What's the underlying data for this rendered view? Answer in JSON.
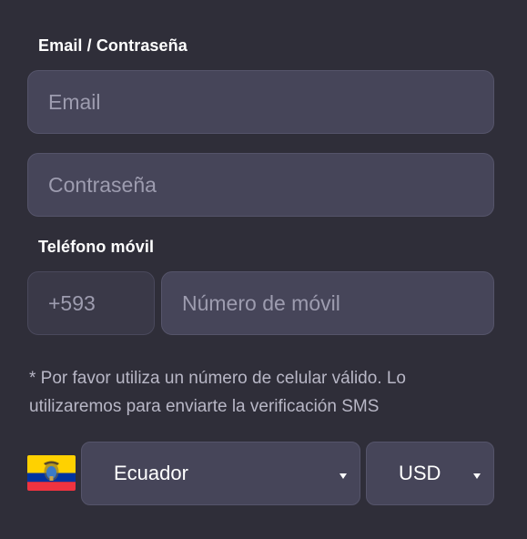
{
  "credentials": {
    "section_label": "Email / Contraseña",
    "email_placeholder": "Email",
    "password_placeholder": "Contraseña"
  },
  "phone": {
    "section_label": "Teléfono móvil",
    "country_code": "+593",
    "number_placeholder": "Número de móvil",
    "note": "* Por favor utiliza un número de celular válido. Lo utilizaremos para enviarte la verificación SMS"
  },
  "country": {
    "flag_icon": "ecuador-flag-icon",
    "selected": "Ecuador"
  },
  "currency": {
    "selected": "USD"
  },
  "colors": {
    "background": "#2f2e39",
    "field": "#464559",
    "flag_yellow": "#ffd100",
    "flag_blue": "#0033a0",
    "flag_red": "#ef3340"
  }
}
